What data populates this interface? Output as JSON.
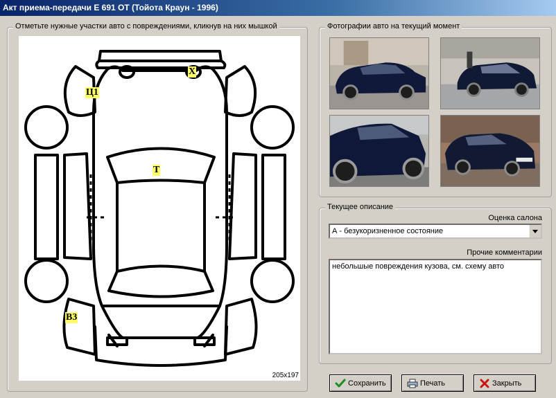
{
  "window": {
    "title": "Акт приема-передачи Е 691 ОТ (Тойота Краун - 1996)"
  },
  "damage_group": {
    "caption": "Отметьте нужные участки авто с повреждениями, кликнув на них мышкой",
    "image_size": "205x197",
    "markers": [
      {
        "id": "X",
        "text": "Х"
      },
      {
        "id": "Ts1",
        "text": "Ц1"
      },
      {
        "id": "T",
        "text": "Т"
      },
      {
        "id": "V3",
        "text": "В3"
      }
    ]
  },
  "photos_group": {
    "caption": "Фотографии авто на текущий момент"
  },
  "description_group": {
    "caption": "Текущее описание",
    "salon_label": "Оценка салона",
    "salon_value": "А - безукоризненное состояние",
    "comments_label": "Прочие комментарии",
    "comments_value": "небольшые повреждения кузова, см. схему авто"
  },
  "buttons": {
    "save": "Сохранить",
    "print": "Печать",
    "close": "Закрыть"
  },
  "colors": {
    "title_start": "#0a246a",
    "title_end": "#a6caf0",
    "marker": "#ffff66"
  }
}
